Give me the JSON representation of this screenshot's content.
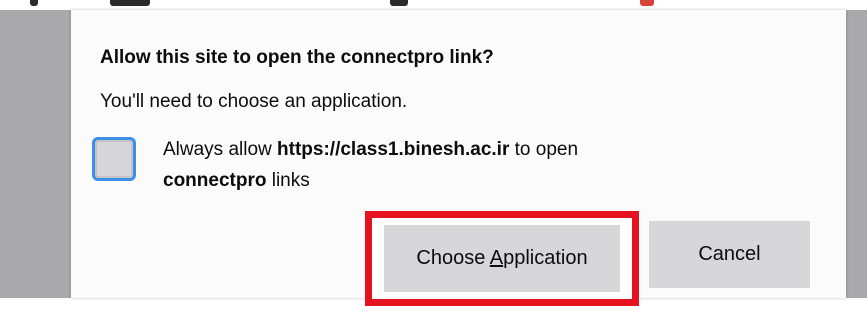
{
  "dialog": {
    "title": "Allow this site to open the connectpro link?",
    "subtitle": "You'll need to choose an application.",
    "checkbox": {
      "checked": false,
      "text_before": "Always allow ",
      "site": "https://class1.binesh.ac.ir",
      "text_middle": " to open",
      "protocol": "connectpro",
      "text_after": " links"
    },
    "buttons": {
      "choose_prefix": "Choose ",
      "choose_accel": "A",
      "choose_suffix": "pplication",
      "cancel": "Cancel"
    }
  },
  "colors": {
    "highlight_box": "#e5131f",
    "checkbox_focus": "#3d8ee6",
    "backdrop": "#a9a9ab"
  }
}
